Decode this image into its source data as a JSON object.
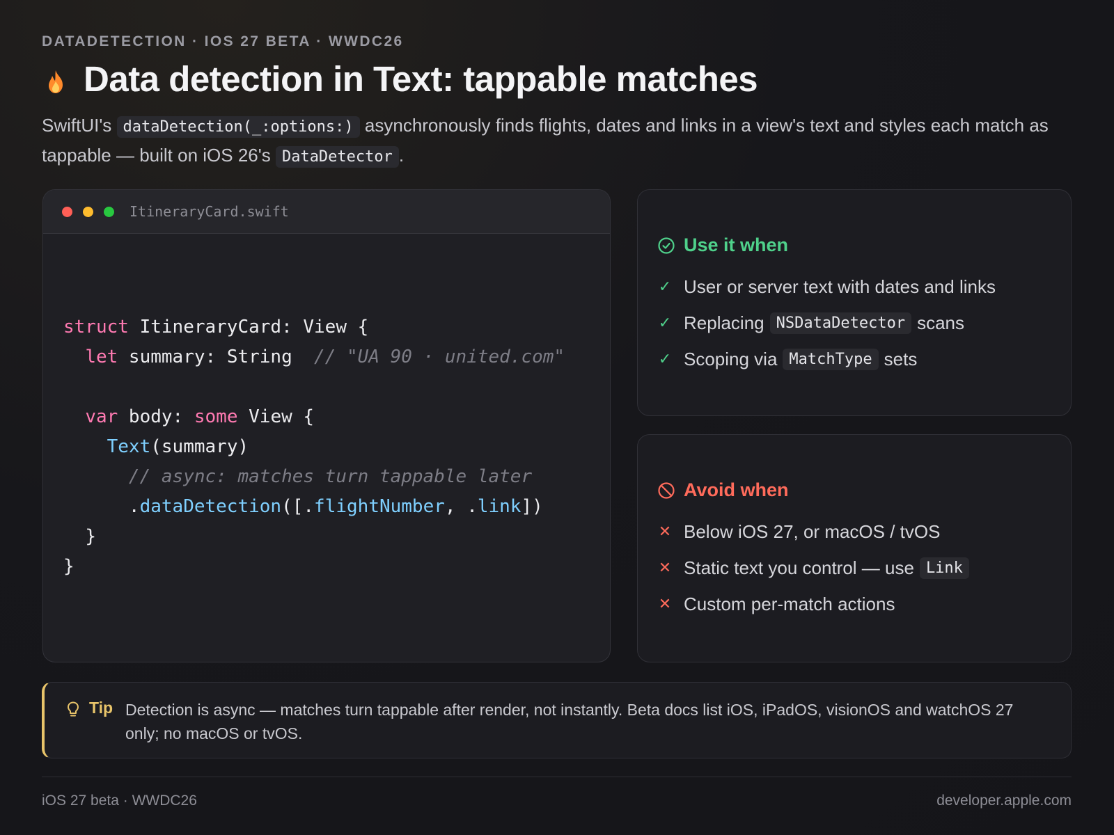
{
  "eyebrow": "DATADETECTION · IOS 27 BETA · WWDC26",
  "title": "Data detection in Text: tappable matches",
  "lede": {
    "part1": "SwiftUI's ",
    "code1": "dataDetection(_:options:)",
    "part2": " asynchronously finds flights, dates and links in a view's text and styles each match as tappable — built on iOS 26's ",
    "code2": "DataDetector",
    "part3": "."
  },
  "code_window": {
    "filename": "ItineraryCard.swift",
    "tokens": {
      "struct": "struct",
      "struct_name": " ItineraryCard: View {",
      "let": "let",
      "let_rest": " summary: String  ",
      "comment1": "// \"UA 90 · united.com\"",
      "var": "var",
      "body_decl": " body: ",
      "some": "some",
      "view_open": " View {",
      "text_fn": "Text",
      "text_arg": "(summary)",
      "comment2": "// async: matches turn tappable later",
      "dot1": ".",
      "modifier": "dataDetection",
      "mod_open": "([.",
      "flight": "flightNumber",
      "mod_mid": ", .",
      "link": "link",
      "mod_close": "])",
      "close_inner": "}",
      "close_outer": "}"
    }
  },
  "use_card": {
    "title": "Use it when",
    "color": "#4fd18b",
    "items": [
      {
        "text": "User or server text with dates and links"
      },
      {
        "pre": "Replacing",
        "code": "NSDataDetector",
        "post": "scans"
      },
      {
        "pre": "Scoping via",
        "code": "MatchType",
        "post": "sets"
      }
    ]
  },
  "avoid_card": {
    "title": "Avoid when",
    "color": "#ff6b5b",
    "items": [
      {
        "text": "Below iOS 27, or macOS / tvOS"
      },
      {
        "pre": "Static text you control — use",
        "code": "Link"
      },
      {
        "text": "Custom per-match actions"
      }
    ]
  },
  "tip": {
    "label": "Tip",
    "text": "Detection is async — matches turn tappable after render, not instantly. Beta docs list iOS, iPadOS, visionOS and watchOS 27 only; no macOS or tvOS.",
    "color": "#e8c46a"
  },
  "footer": {
    "left": "iOS 27 beta · WWDC26",
    "right": "developer.apple.com"
  }
}
